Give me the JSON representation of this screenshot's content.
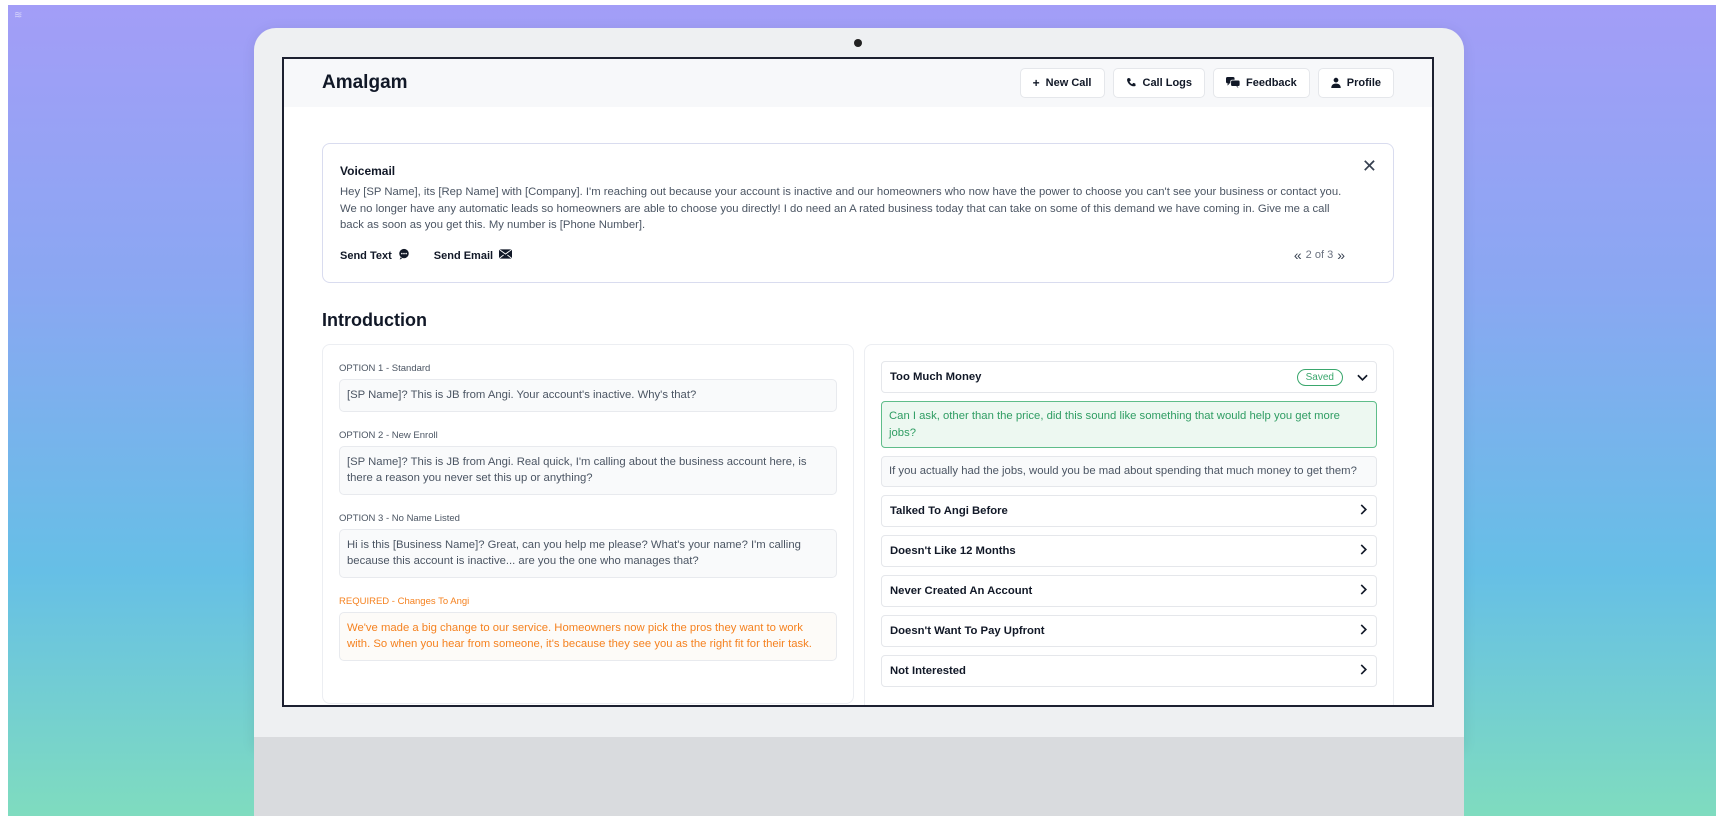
{
  "app": {
    "name": "Amalgam"
  },
  "nav": [
    {
      "label": "New Call",
      "icon": "plus-icon"
    },
    {
      "label": "Call Logs",
      "icon": "phone-icon"
    },
    {
      "label": "Feedback",
      "icon": "chat-bubbles-icon"
    },
    {
      "label": "Profile",
      "icon": "person-icon"
    }
  ],
  "voicemail": {
    "title": "Voicemail",
    "body": "Hey [SP Name], its [Rep Name] with [Company]. I'm reaching out because your account is inactive and our homeowners who now have the power to choose you can't see your business or contact you. We no longer have any automatic leads so homeowners are able to choose you directly! I do need an A rated business today that can take on some of this demand we have coming in. Give me a call back as soon as you get this. My number is [Phone Number].",
    "send_text": "Send Text",
    "send_email": "Send Email",
    "pager": "2 of 3"
  },
  "introduction": {
    "title": "Introduction",
    "options": [
      {
        "label": "OPTION 1 - Standard",
        "text": "[SP Name]? This is JB from Angi. Your account's inactive. Why's that?"
      },
      {
        "label": "OPTION 2 - New Enroll",
        "text": "[SP Name]? This is JB from Angi. Real quick, I'm calling about the business account here, is there a reason you never set this up or anything?"
      },
      {
        "label": "OPTION 3 - No Name Listed",
        "text": "Hi is this [Business Name]? Great, can you help me please? What's your name? I'm calling because this account is inactive... are you the one who manages that?"
      }
    ],
    "required": {
      "label": "REQUIRED - Changes To Angi",
      "text": "We've made a big change to our service. Homeowners now pick the pros they want to work with. So when you hear from someone, it's because they see you as the right fit for their task."
    }
  },
  "objections": {
    "expanded": {
      "title": "Too Much Money",
      "badge": "Saved",
      "responses": [
        "Can I ask, other than the price, did this sound like something that would help you get more jobs?",
        "If you actually had the jobs, would you be mad about spending that much money to get them?"
      ]
    },
    "collapsed": [
      "Talked To Angi Before",
      "Doesn't Like 12 Months",
      "Never Created An Account",
      "Doesn't Want To Pay Upfront",
      "Not Interested"
    ]
  },
  "colors": {
    "saved_green": "#3aa76d",
    "required_orange": "#f58220"
  }
}
